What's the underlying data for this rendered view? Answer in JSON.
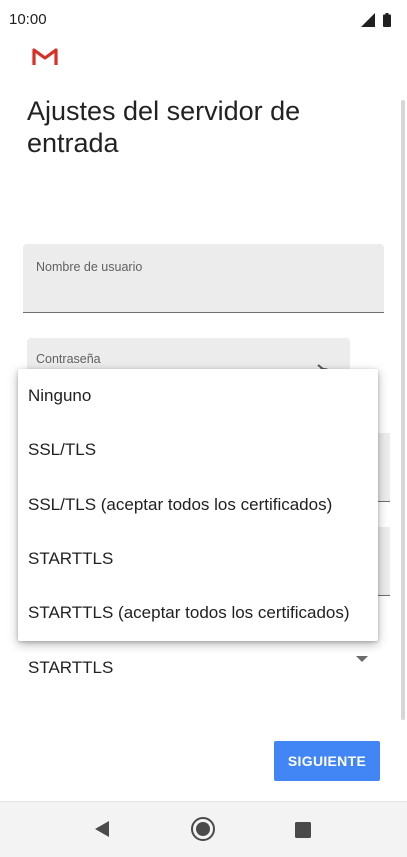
{
  "status_bar": {
    "time": "10:00"
  },
  "header": {
    "logo": "gmail-logo",
    "title": "Ajustes del servidor de entrada"
  },
  "form": {
    "username_label": "Nombre de usuario",
    "password_label": "Contraseña",
    "security_value": "STARTTLS"
  },
  "dropdown": {
    "options": [
      "Ninguno",
      "SSL/TLS",
      "SSL/TLS (aceptar todos los certificados)",
      "STARTTLS",
      "STARTTLS (aceptar todos los certificados)"
    ]
  },
  "actions": {
    "next_label": "SIGUIENTE"
  },
  "colors": {
    "accent": "#4285f4",
    "gmail_red": "#d93025"
  },
  "icons": [
    "signal-icon",
    "battery-icon",
    "eye-off-icon",
    "dropdown-arrow-icon",
    "back-icon",
    "home-icon",
    "recents-icon"
  ]
}
